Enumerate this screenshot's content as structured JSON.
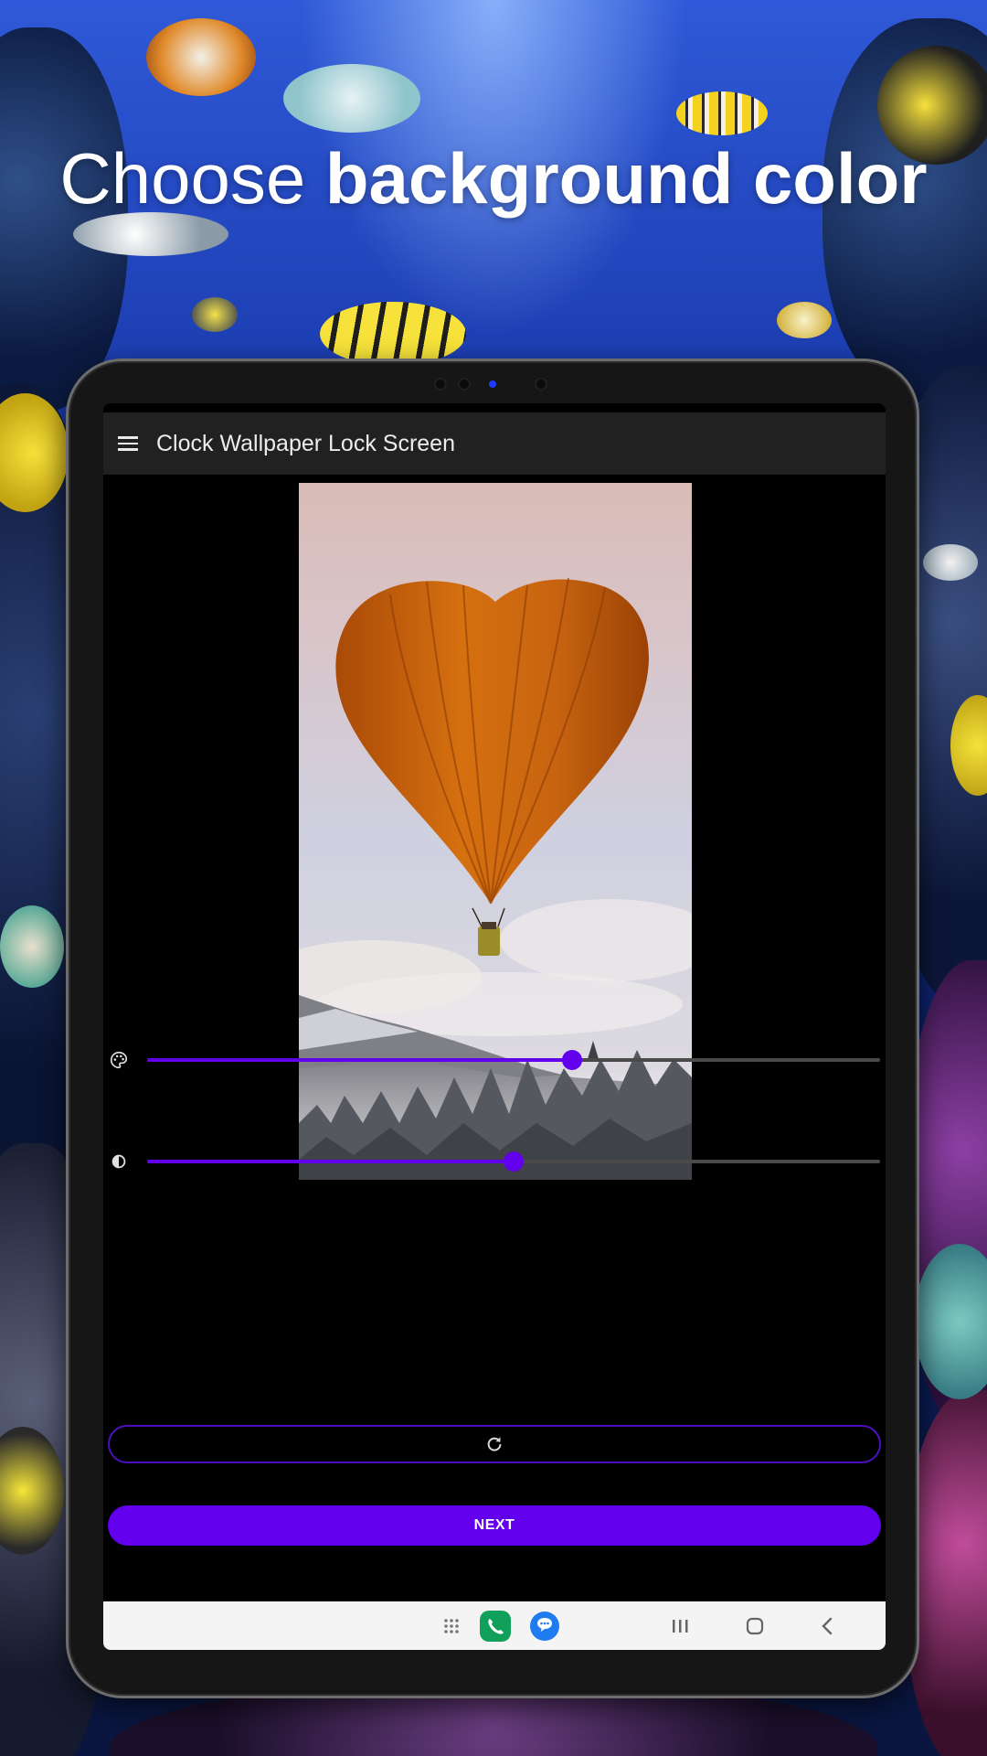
{
  "headline": {
    "light": "Choose",
    "bold": "background color"
  },
  "app": {
    "title": "Clock Wallpaper Lock Screen"
  },
  "sliders": [
    {
      "name": "color",
      "icon": "palette-icon",
      "value": 0.58
    },
    {
      "name": "brightness",
      "icon": "contrast-icon",
      "value": 0.5
    }
  ],
  "buttons": {
    "reset_icon": "refresh-icon",
    "next_label": "NEXT"
  },
  "colors": {
    "accent": "#6200ee",
    "appbar": "#212121",
    "balloon": "#c8620f"
  },
  "navbar": {
    "icons": [
      "apps-grid-icon",
      "phone-app-icon",
      "messages-app-icon",
      "recents-icon",
      "home-icon",
      "back-icon"
    ]
  }
}
